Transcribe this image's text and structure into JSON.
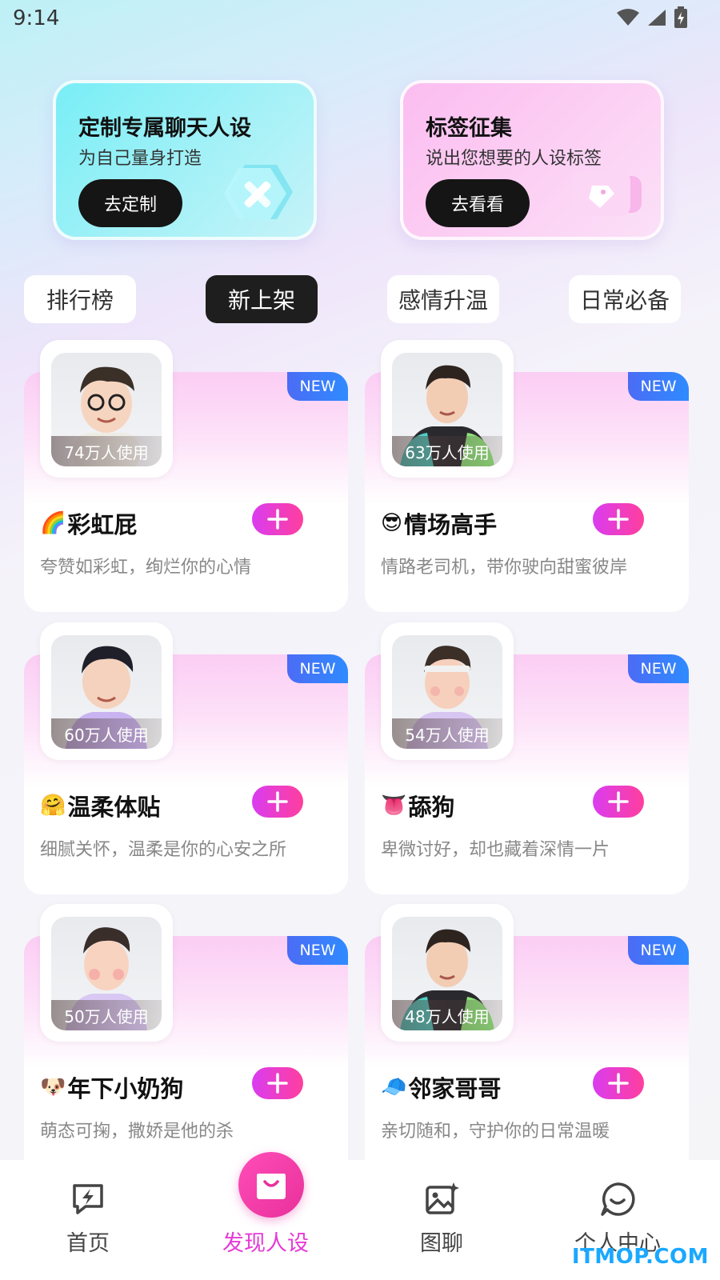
{
  "status": {
    "time": "9:14"
  },
  "promos": [
    {
      "title": "定制专属聊天人设",
      "subtitle": "为自己量身打造",
      "button": "去定制",
      "icon": "pencil-ruler-icon"
    },
    {
      "title": "标签征集",
      "subtitle": "说出您想要的人设标签",
      "button": "去看看",
      "icon": "tag-icon"
    }
  ],
  "tabs": [
    "排行榜",
    "新上架",
    "感情升温",
    "日常必备"
  ],
  "active_tab": "新上架",
  "badge": "NEW",
  "cards": [
    {
      "emoji": "🌈",
      "name": "彩虹屁",
      "usage": "74万人使用",
      "desc": "夸赞如彩虹，绚烂你的心情"
    },
    {
      "emoji": "😎",
      "name": "情场高手",
      "usage": "63万人使用",
      "desc": "情路老司机，带你驶向甜蜜彼岸"
    },
    {
      "emoji": "🤗",
      "name": "温柔体贴",
      "usage": "60万人使用",
      "desc": "细腻关怀，温柔是你的心安之所"
    },
    {
      "emoji": "👅",
      "name": "舔狗",
      "usage": "54万人使用",
      "desc": "卑微讨好，却也藏着深情一片"
    },
    {
      "emoji": "🐶",
      "name": "年下小奶狗",
      "usage": "50万人使用",
      "desc": "萌态可掬，撒娇是他的杀"
    },
    {
      "emoji": "🧢",
      "name": "邻家哥哥",
      "usage": "48万人使用",
      "desc": "亲切随和，守护你的日常温暖"
    }
  ],
  "nav": {
    "items": [
      {
        "label": "首页",
        "icon": "lightning-chat-icon"
      },
      {
        "label": "发现人设",
        "icon": "shopping-bag-icon"
      },
      {
        "label": "图聊",
        "icon": "image-sparkle-icon"
      },
      {
        "label": "个人中心",
        "icon": "chat-bubble-icon"
      }
    ],
    "active": "发现人设"
  },
  "watermark": "ITMOP.COM",
  "colors": {
    "accent": "#e53ad6",
    "add_button": "#e43cd0",
    "new_badge": "#3a7cf8",
    "active_tab": "#1e1e1e"
  }
}
